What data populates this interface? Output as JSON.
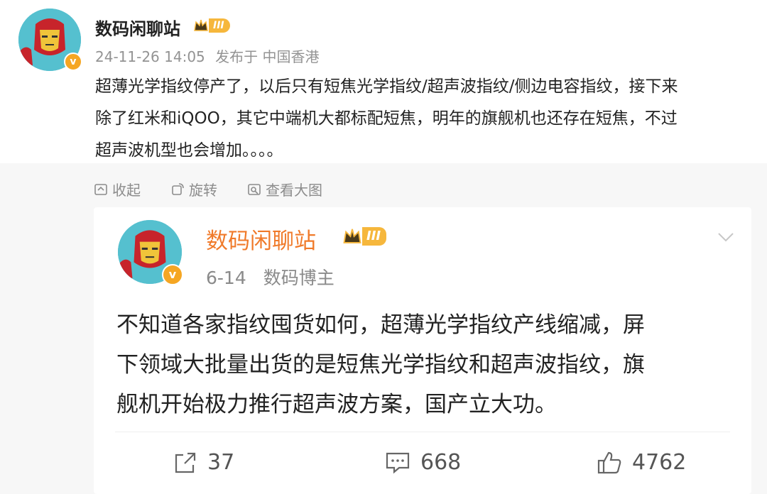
{
  "post": {
    "author": "数码闲聊站",
    "level_badge": "III",
    "timestamp": "24-11-26 14:05",
    "location": "发布于 中国香港",
    "text": "超薄光学指纹停产了，以后只有短焦光学指纹/超声波指纹/侧边电容指纹，接下来除了红米和iQOO，其它中端机大都标配短焦，明年的旗舰机也还存在短焦，不过超声波机型也会增加。。。。",
    "lines": [
      "超薄光学指纹停产了，以后只有短焦光学指纹/超声波指纹/侧边电容指纹，接下来",
      "除了红米和iQOO，其它中端机大都标配短焦，明年的旗舰机也还存在短焦，不过",
      "超声波机型也会增加。。。。"
    ]
  },
  "image_actions": {
    "collapse": "收起",
    "rotate": "旋转",
    "view_large": "查看大图"
  },
  "quoted": {
    "author": "数码闲聊站",
    "level_badge": "III",
    "date": "6-14",
    "role": "数码博主",
    "lines": [
      "不知道各家指纹囤货如何，超薄光学指纹产线缩减，屏",
      "下领域大批量出货的是短焦光学指纹和超声波指纹，旗",
      "舰机开始极力推行超声波方案，国产立大功。"
    ],
    "reposts": "37",
    "comments": "668",
    "likes": "4762"
  },
  "colors": {
    "quoted_author": "#f07a2a",
    "badge_gold": "#f6b73c",
    "verified": "#f5a623"
  },
  "icons": [
    "collapse-icon",
    "rotate-icon",
    "view-large-icon",
    "chevron-down-icon",
    "repost-icon",
    "comment-icon",
    "like-icon"
  ]
}
